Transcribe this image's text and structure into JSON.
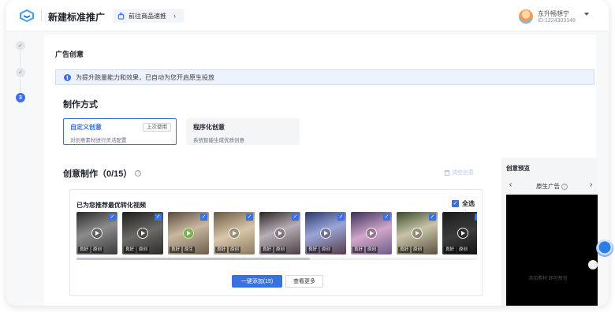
{
  "header": {
    "title": "新建标准推广",
    "goods_link": "前往商品速推",
    "user_name": "东升畅想宁",
    "user_id": "ID:1224303148"
  },
  "steps": [
    {
      "label": "✓",
      "state": "done"
    },
    {
      "label": "✓",
      "state": "done"
    },
    {
      "label": "3",
      "state": "active"
    }
  ],
  "section_title": "广告创意",
  "notice": "为提升跑量能力和效果，已自动为您开启原生投放",
  "make_method": {
    "title": "制作方式",
    "options": [
      {
        "title": "自定义创意",
        "desc": "对创意素材进行灵活配置",
        "badge": "上次使用",
        "selected": true
      },
      {
        "title": "程序化创意",
        "desc": "系统智能生成优质创意",
        "selected": false
      }
    ]
  },
  "creative": {
    "title": "创意制作（0/15）",
    "clear_label": "清空创意"
  },
  "recommend": {
    "title": "已为您推荐最优转化视频",
    "select_all": "全选",
    "videos": [
      {
        "tags": [
          "良好",
          "原创"
        ],
        "play_style": "white",
        "bg": "linear-gradient(160deg,#2b2b2b,#8c8c8c 45%,#3a3a3a)"
      },
      {
        "tags": [
          "良好",
          "原创"
        ],
        "play_style": "white",
        "bg": "linear-gradient(160deg,#1e1e1e,#6d6a66 50%,#2a2a2a)"
      },
      {
        "tags": [
          "良好",
          "原生"
        ],
        "play_style": "green",
        "bg": "linear-gradient(160deg,#5c4a3c,#c9b8a0 45%,#6d5d4c)"
      },
      {
        "tags": [
          "良好",
          "原创"
        ],
        "play_style": "white",
        "bg": "linear-gradient(160deg,#6b5a44,#d8c6a8 50%,#8b7a62)"
      },
      {
        "tags": [
          "良好",
          "原创"
        ],
        "play_style": "white",
        "bg": "linear-gradient(160deg,#2a2624,#b8aeb6 45%,#4a4044)"
      },
      {
        "tags": [
          "良好",
          "原创"
        ],
        "play_style": "white",
        "bg": "linear-gradient(160deg,#2b3a6a,#9aa6d8 45%,#5a3a4a)"
      },
      {
        "tags": [
          "良好",
          "原创"
        ],
        "play_style": "white",
        "bg": "linear-gradient(160deg,#3a2f5c,#d2a6c9 50%,#6d5c8c)"
      },
      {
        "tags": [
          "良好",
          "原创"
        ],
        "play_style": "white",
        "bg": "linear-gradient(160deg,#3a4a2c,#c8c4a8 45%,#5a5040)"
      },
      {
        "tags": [
          "良好",
          "原创"
        ],
        "play_style": "white",
        "bg": "linear-gradient(160deg,#1a1a1a,#3c3c3c 50%,#101010)"
      }
    ],
    "add_button": "一键添加(15)",
    "more_button": "查看更多"
  },
  "preview": {
    "title": "创意预览",
    "label": "原生广告",
    "empty_text": "添加素材 即可预览"
  },
  "colors": {
    "accent": "#3b70e0",
    "notice_bg": "#edf3fe"
  }
}
